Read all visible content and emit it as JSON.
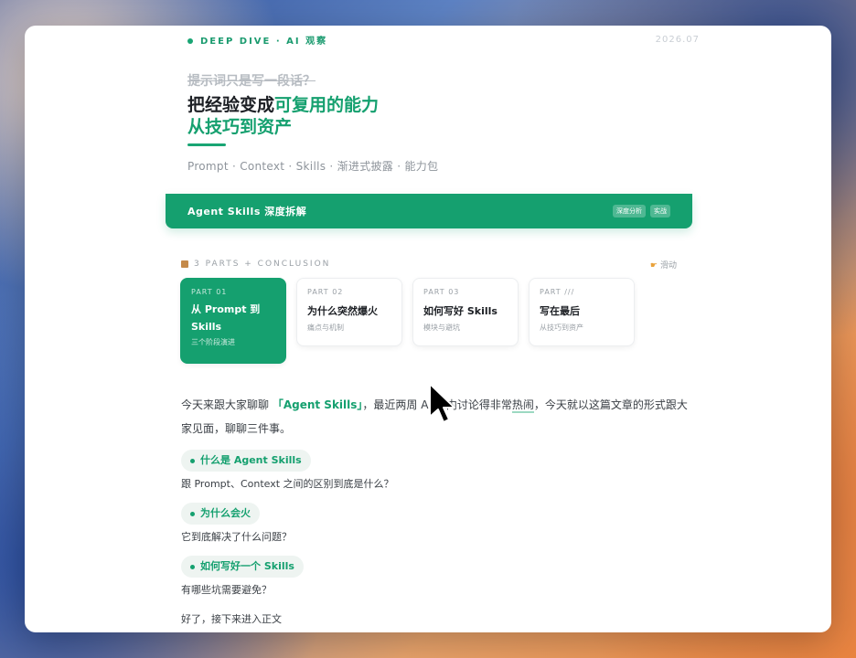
{
  "header": {
    "eyebrow": "DEEP DIVE · AI 观察",
    "date": "2026.07",
    "strike": "提示词只是写一段话？",
    "title_line1_prefix": "把经验变成",
    "title_line1_accent": "可复用的能力",
    "title_line2": "从技巧到资产",
    "subtitle": "Prompt · Context · Skills · 渐进式披露 · 能力包"
  },
  "banner": {
    "title": "Agent Skills 深度拆解",
    "tags": [
      "深度分析",
      "实战"
    ]
  },
  "parts": {
    "heading": "3 PARTS + CONCLUSION",
    "scroll_hint": "滑动",
    "items": [
      {
        "tag": "PART 01",
        "name": "从 Prompt 到 Skills",
        "desc": "三个阶段演进",
        "active": true
      },
      {
        "tag": "PART 02",
        "name": "为什么突然爆火",
        "desc": "痛点与机制",
        "active": false
      },
      {
        "tag": "PART 03",
        "name": "如何写好 Skills",
        "desc": "模块与避坑",
        "active": false
      },
      {
        "tag": "PART ///",
        "name": "写在最后",
        "desc": "从技巧到资产",
        "active": false
      }
    ]
  },
  "article": {
    "intro_a": "今天来跟大家聊聊 ",
    "intro_highlight": "「Agent Skills」",
    "intro_b": "，最近两周 AI 圈",
    "intro_hidden": "内",
    "intro_c": "讨论得非常",
    "intro_underline": "热闹",
    "intro_d": "，今天就以这篇文章的形式跟大家见面，聊聊三件事。",
    "points": [
      {
        "label": "什么是 Agent Skills",
        "question": "跟 Prompt、Context 之间的区别到底是什么？"
      },
      {
        "label": "为什么会火",
        "question": "它到底解决了什么问题？"
      },
      {
        "label": "如何写好一个 Skills",
        "question": "有哪些坑需要避免？"
      }
    ],
    "transition": "好了，接下来进入正文"
  },
  "colors": {
    "accent": "#15a06f",
    "text": "#1c1f24",
    "muted": "#9aa0a6"
  },
  "icons": {
    "parts_icon": "package-icon",
    "scroll_icon": "pointing-hand-icon",
    "cursor": "mouse-pointer-icon"
  }
}
